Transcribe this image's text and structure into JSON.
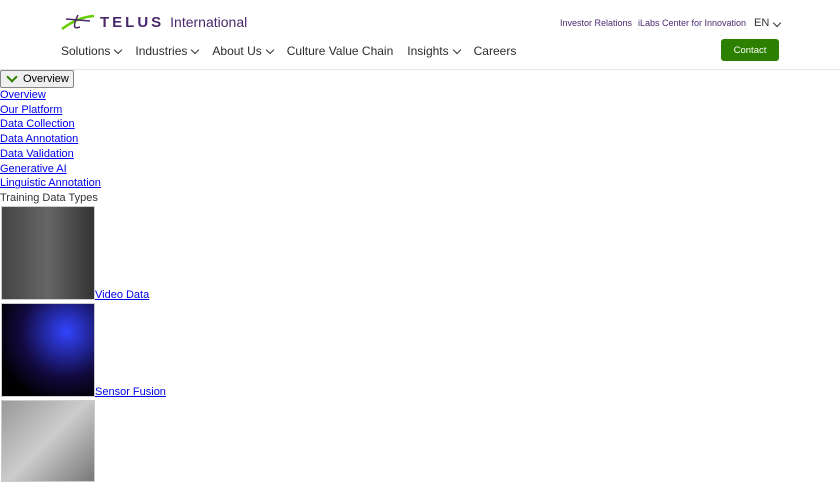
{
  "header": {
    "brand": "TELUS",
    "brand_suffix": "International",
    "top_links": [
      "Investor Relations",
      "iLabs Center for Innovation"
    ],
    "language": "EN",
    "contact": "Contact",
    "nav": [
      {
        "label": "Solutions",
        "dropdown": true
      },
      {
        "label": "Industries",
        "dropdown": true
      },
      {
        "label": "About Us",
        "dropdown": true
      },
      {
        "label": "Culture Value Chain",
        "dropdown": false
      },
      {
        "label": "Insights",
        "dropdown": true
      },
      {
        "label": "Careers",
        "dropdown": false
      }
    ]
  },
  "subnav": {
    "select": "Overview",
    "links": [
      "Overview",
      "Our Platform",
      "Data Collection",
      "Data Annotation",
      "Data Validation",
      "Generative AI",
      "Linguistic Annotation"
    ],
    "section": "Training Data Types"
  },
  "cards": [
    "Video Data",
    "Sensor Fusion"
  ]
}
